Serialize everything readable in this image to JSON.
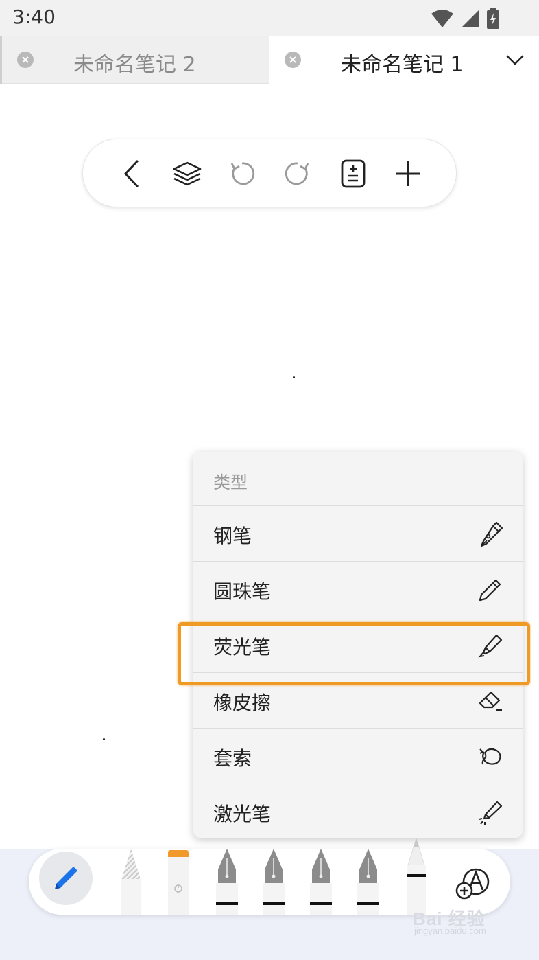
{
  "status_bar": {
    "time": "3:40",
    "icons": [
      "wifi-icon",
      "cellular-signal-icon",
      "battery-charging-icon"
    ]
  },
  "tabs": [
    {
      "title": "未命名笔记 2",
      "active": false
    },
    {
      "title": "未命名笔记 1",
      "active": true
    }
  ],
  "toolbar": {
    "buttons": [
      "back-icon",
      "layers-icon",
      "undo-icon",
      "redo-icon",
      "page-settings-icon",
      "add-icon"
    ]
  },
  "type_menu": {
    "header": "类型",
    "items": [
      {
        "label": "钢笔",
        "icon": "fountain-pen-icon"
      },
      {
        "label": "圆珠笔",
        "icon": "ballpoint-pen-icon"
      },
      {
        "label": "荧光笔",
        "icon": "highlighter-icon",
        "highlighted": true
      },
      {
        "label": "橡皮擦",
        "icon": "eraser-icon"
      },
      {
        "label": "套索",
        "icon": "lasso-icon"
      },
      {
        "label": "激光笔",
        "icon": "laser-pointer-icon"
      }
    ]
  },
  "pen_tray": {
    "selected_tool": "pencil-icon",
    "tools": [
      "pencil-tool",
      "highlighter-tool",
      "fountain-pen-tool-1",
      "fountain-pen-tool-2",
      "fountain-pen-tool-3",
      "fountain-pen-tool-4",
      "marker-tool"
    ],
    "add_tool": "add-pen-icon"
  },
  "colors": {
    "highlight_border": "#f09a26",
    "pencil_blue": "#1a73e8",
    "tray_background": "#edf0f9"
  },
  "watermark": {
    "main": "Bai 经验",
    "sub": "jingyan.baidu.com"
  }
}
